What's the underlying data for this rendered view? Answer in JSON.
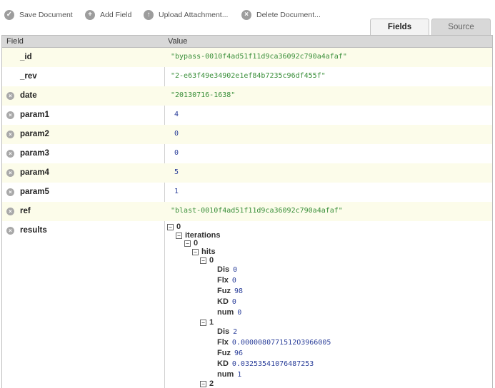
{
  "toolbar": {
    "save": "Save Document",
    "add": "Add Field",
    "upload": "Upload Attachment...",
    "delete": "Delete Document..."
  },
  "tabs": {
    "fields": "Fields",
    "source": "Source"
  },
  "table": {
    "col_field": "Field",
    "col_value": "Value"
  },
  "rows": [
    {
      "field": "_id",
      "value": "\"bypass-0010f4ad51f11d9ca36092c790a4afaf\""
    },
    {
      "field": "_rev",
      "value": "\"2-e63f49e34902e1ef84b7235c96df455f\""
    },
    {
      "field": "date",
      "value": "\"20130716-1638\""
    },
    {
      "field": "param1",
      "value": "4"
    },
    {
      "field": "param2",
      "value": "0"
    },
    {
      "field": "param3",
      "value": "0"
    },
    {
      "field": "param4",
      "value": "5"
    },
    {
      "field": "param5",
      "value": "1"
    },
    {
      "field": "ref",
      "value": "\"blast-0010f4ad51f11d9ca36092c790a4afaf\""
    },
    {
      "field": "results",
      "value": ""
    }
  ],
  "tree": {
    "root": "0",
    "iterations": "iterations",
    "iter0": "0",
    "hits": "hits",
    "hit0": {
      "key": "0",
      "Dis": "0",
      "Flx": "0",
      "Fuz": "98",
      "KD": "0",
      "num": "0"
    },
    "hit1": {
      "key": "1",
      "Dis": "2",
      "Flx": "0.0000080771512O3966005",
      "Fuz": "96",
      "KD": "0.03253541076487253",
      "num": "1"
    },
    "hit2": {
      "key": "2"
    },
    "labels": {
      "Dis": "Dis",
      "Flx": "Flx",
      "Fuz": "Fuz",
      "KD": "KD",
      "num": "num"
    }
  }
}
